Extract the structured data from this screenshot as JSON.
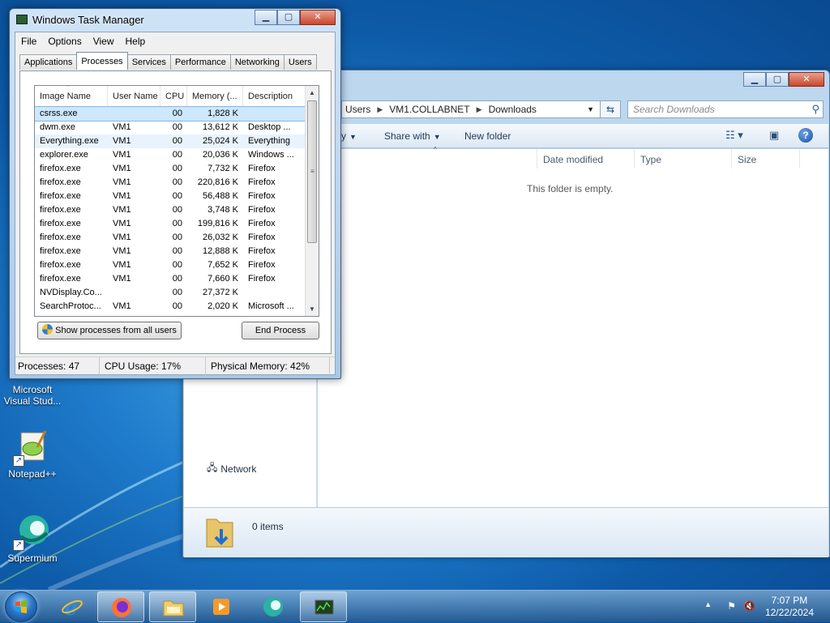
{
  "desktop": {
    "icons": [
      {
        "label_line1": "Microsoft",
        "label_line2": "Visual Stud..."
      },
      {
        "label_line1": "Notepad++",
        "label_line2": ""
      },
      {
        "label_line1": "Supermium",
        "label_line2": ""
      }
    ]
  },
  "explorer": {
    "address": [
      "Users",
      "VM1.COLLABNET",
      "Downloads"
    ],
    "search_placeholder": "Search Downloads",
    "commands": {
      "organize_tail": "y",
      "share_with": "Share with",
      "new_folder": "New folder"
    },
    "columns": {
      "name": "me",
      "date_modified": "Date modified",
      "type": "Type",
      "size": "Size"
    },
    "empty_message": "This folder is empty.",
    "nav_network": "Network",
    "items_count": "0 items"
  },
  "taskmgr": {
    "title": "Windows Task Manager",
    "menu": [
      "File",
      "Options",
      "View",
      "Help"
    ],
    "tabs": [
      "Applications",
      "Processes",
      "Services",
      "Performance",
      "Networking",
      "Users"
    ],
    "columns": [
      "Image Name",
      "User Name",
      "CPU",
      "Memory (...",
      "Description"
    ],
    "processes": [
      {
        "name": "csrss.exe",
        "user": "",
        "cpu": "00",
        "mem": "1,828 K",
        "desc": ""
      },
      {
        "name": "dwm.exe",
        "user": "VM1",
        "cpu": "00",
        "mem": "13,612 K",
        "desc": "Desktop ..."
      },
      {
        "name": "Everything.exe",
        "user": "VM1",
        "cpu": "00",
        "mem": "25,024 K",
        "desc": "Everything"
      },
      {
        "name": "explorer.exe",
        "user": "VM1",
        "cpu": "00",
        "mem": "20,036 K",
        "desc": "Windows ..."
      },
      {
        "name": "firefox.exe",
        "user": "VM1",
        "cpu": "00",
        "mem": "7,732 K",
        "desc": "Firefox"
      },
      {
        "name": "firefox.exe",
        "user": "VM1",
        "cpu": "00",
        "mem": "220,816 K",
        "desc": "Firefox"
      },
      {
        "name": "firefox.exe",
        "user": "VM1",
        "cpu": "00",
        "mem": "56,488 K",
        "desc": "Firefox"
      },
      {
        "name": "firefox.exe",
        "user": "VM1",
        "cpu": "00",
        "mem": "3,748 K",
        "desc": "Firefox"
      },
      {
        "name": "firefox.exe",
        "user": "VM1",
        "cpu": "00",
        "mem": "199,816 K",
        "desc": "Firefox"
      },
      {
        "name": "firefox.exe",
        "user": "VM1",
        "cpu": "00",
        "mem": "26,032 K",
        "desc": "Firefox"
      },
      {
        "name": "firefox.exe",
        "user": "VM1",
        "cpu": "00",
        "mem": "12,888 K",
        "desc": "Firefox"
      },
      {
        "name": "firefox.exe",
        "user": "VM1",
        "cpu": "00",
        "mem": "7,652 K",
        "desc": "Firefox"
      },
      {
        "name": "firefox.exe",
        "user": "VM1",
        "cpu": "00",
        "mem": "7,660 K",
        "desc": "Firefox"
      },
      {
        "name": "NVDisplay.Co...",
        "user": "",
        "cpu": "00",
        "mem": "27,372 K",
        "desc": ""
      },
      {
        "name": "SearchProtoc...",
        "user": "VM1",
        "cpu": "00",
        "mem": "2,020 K",
        "desc": "Microsoft ..."
      }
    ],
    "show_all_label": "Show processes from all users",
    "end_process_label": "End Process",
    "status": {
      "processes": "Processes: 47",
      "cpu": "CPU Usage: 17%",
      "memory": "Physical Memory: 42%"
    }
  },
  "taskbar": {
    "clock_time": "7:07 PM",
    "clock_date": "12/22/2024"
  },
  "colors": {
    "selection": "#cde8ff",
    "accent": "#1f7ccc"
  }
}
